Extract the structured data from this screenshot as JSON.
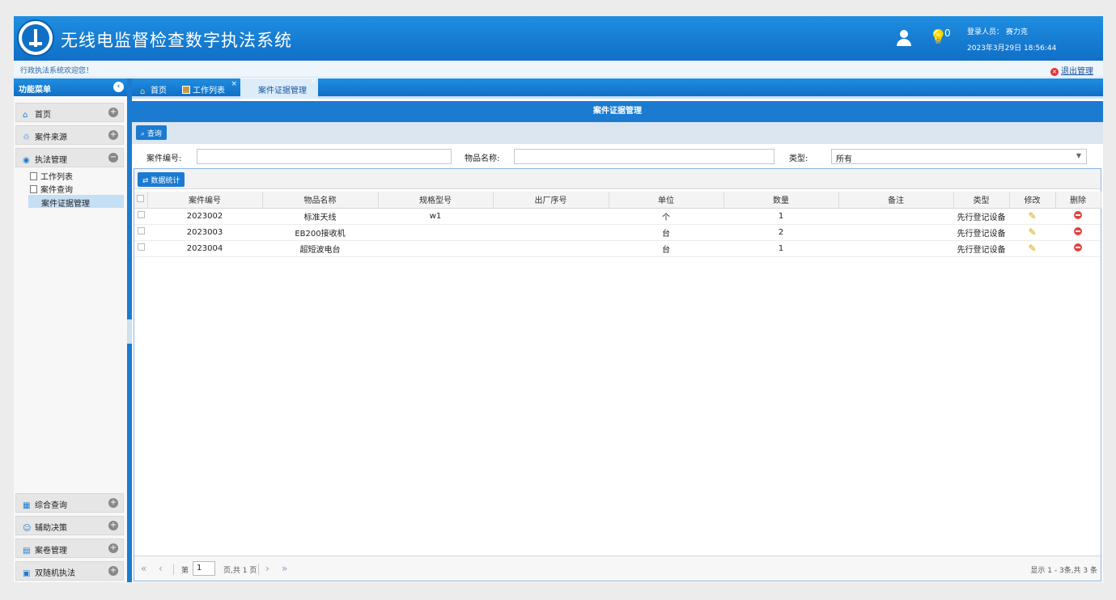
{
  "header": {
    "title": "无线电监督检查数字执法系统",
    "login_label": "登录人员：  赛力克",
    "login_time": "2023年3月29日 18:56:44",
    "notification_count": "0"
  },
  "subbar": {
    "welcome": "行政执法系统欢迎您！",
    "logout": "退出管理"
  },
  "sidebar": {
    "title": "功能菜单",
    "items": [
      {
        "label": "首页"
      },
      {
        "label": "案件来源"
      },
      {
        "label": "执法管理"
      },
      {
        "label": "综合查询"
      },
      {
        "label": "辅助决策"
      },
      {
        "label": "案卷管理"
      },
      {
        "label": "双随机执法"
      }
    ],
    "subitems": [
      "工作列表",
      "案件查询",
      "案件证据管理"
    ]
  },
  "tabs": [
    {
      "label": "首页"
    },
    {
      "label": "工作列表"
    },
    {
      "label": "案件证据管理"
    }
  ],
  "panel": {
    "title": "案件证据管理",
    "query_button": "查询",
    "stats_button": "数据统计"
  },
  "form": {
    "case_no_label": "案件编号:",
    "item_name_label": "物品名称:",
    "type_label": "类型:",
    "type_value": "所有"
  },
  "table": {
    "columns": [
      "案件编号",
      "物品名称",
      "规格型号",
      "出厂序号",
      "单位",
      "数量",
      "备注",
      "类型",
      "修改",
      "删除"
    ],
    "rows": [
      {
        "case_no": "2023002",
        "name": "标准天线",
        "model": "w1",
        "serial": "",
        "unit": "个",
        "qty": "1",
        "note": "",
        "type": "先行登记设备"
      },
      {
        "case_no": "2023003",
        "name": "EB200接收机",
        "model": "",
        "serial": "",
        "unit": "台",
        "qty": "2",
        "note": "",
        "type": "先行登记设备"
      },
      {
        "case_no": "2023004",
        "name": "超短波电台",
        "model": "",
        "serial": "",
        "unit": "台",
        "qty": "1",
        "note": "",
        "type": "先行登记设备"
      }
    ]
  },
  "pager": {
    "page_prefix": "第",
    "page_value": "1",
    "page_suffix": "页,共 1 页",
    "info": "显示 1 - 3条,共 3 条"
  }
}
